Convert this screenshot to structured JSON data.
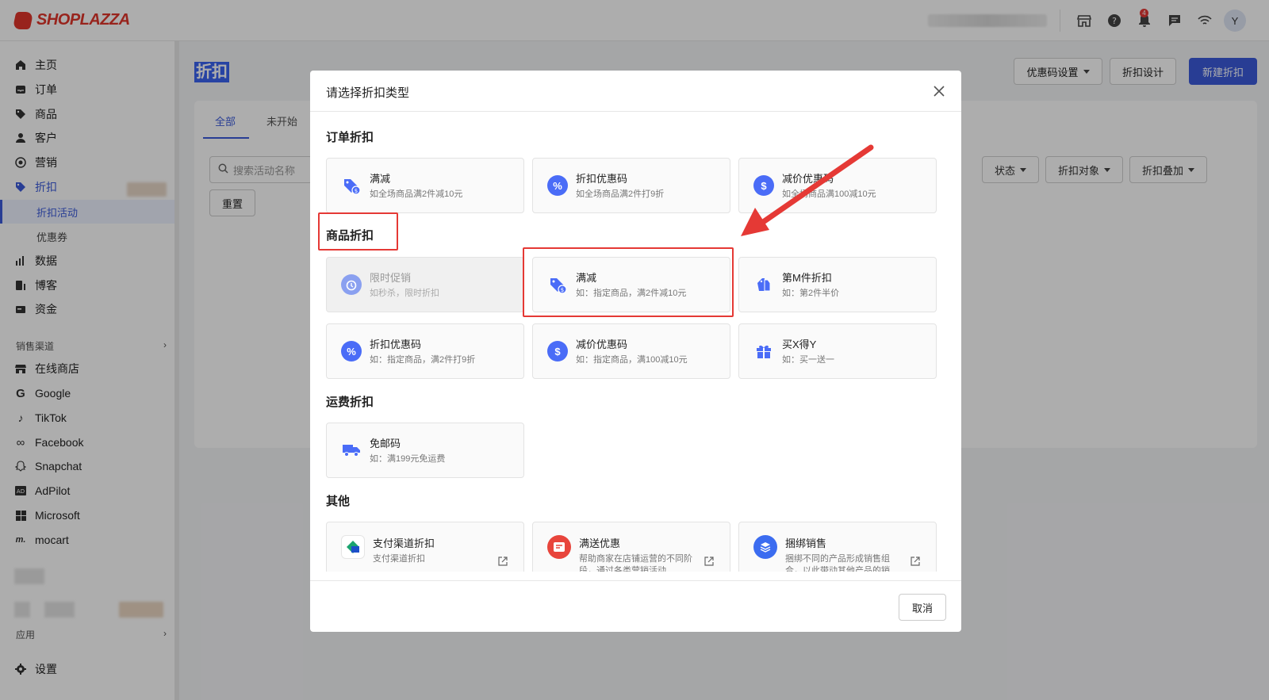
{
  "brand": {
    "name": "SHOPLAZZA"
  },
  "topbar": {
    "notification_count": "4",
    "avatar_letter": "Y"
  },
  "sidebar": {
    "items": [
      {
        "label": "主页",
        "icon": "home-icon"
      },
      {
        "label": "订单",
        "icon": "inbox-icon"
      },
      {
        "label": "商品",
        "icon": "tag-icon"
      },
      {
        "label": "客户",
        "icon": "person-icon"
      },
      {
        "label": "营销",
        "icon": "target-icon"
      },
      {
        "label": "折扣",
        "icon": "discount-icon"
      }
    ],
    "sub_items": [
      {
        "label": "折扣活动"
      },
      {
        "label": "优惠券"
      }
    ],
    "items2": [
      {
        "label": "数据",
        "icon": "bar-chart-icon"
      },
      {
        "label": "博客",
        "icon": "blog-icon"
      },
      {
        "label": "资金",
        "icon": "wallet-icon"
      }
    ],
    "channels_label": "销售渠道",
    "channels": [
      {
        "label": "在线商店",
        "icon": "store-icon"
      },
      {
        "label": "Google",
        "icon": "google-icon"
      },
      {
        "label": "TikTok",
        "icon": "tiktok-icon"
      },
      {
        "label": "Facebook",
        "icon": "meta-icon"
      },
      {
        "label": "Snapchat",
        "icon": "snapchat-icon"
      },
      {
        "label": "AdPilot",
        "icon": "ad-icon"
      },
      {
        "label": "Microsoft",
        "icon": "microsoft-icon"
      },
      {
        "label": "mocart",
        "icon": "mocart-icon"
      }
    ],
    "apps_label": "应用",
    "settings_label": "设置"
  },
  "page": {
    "title": "折扣",
    "buttons": {
      "coupon_settings": "优惠码设置",
      "discount_design": "折扣设计",
      "new_discount": "新建折扣"
    },
    "tabs": [
      "全部",
      "未开始"
    ],
    "search_placeholder": "搜索活动名称",
    "filters": [
      "状态",
      "折扣对象",
      "折扣叠加"
    ],
    "reset": "重置"
  },
  "modal": {
    "title": "请选择折扣类型",
    "sections": [
      "订单折扣",
      "商品折扣",
      "运费折扣",
      "其他"
    ],
    "order": [
      {
        "title": "满减",
        "desc": "如全场商品满2件减10元"
      },
      {
        "title": "折扣优惠码",
        "desc": "如全场商品满2件打9折"
      },
      {
        "title": "减价优惠码",
        "desc": "如全场商品满100减10元"
      }
    ],
    "product": [
      {
        "title": "限时促销",
        "desc": "如秒杀，限时折扣"
      },
      {
        "title": "满减",
        "desc": "如：指定商品，满2件减10元"
      },
      {
        "title": "第M件折扣",
        "desc": "如：第2件半价"
      },
      {
        "title": "折扣优惠码",
        "desc": "如：指定商品，满2件打9折"
      },
      {
        "title": "减价优惠码",
        "desc": "如：指定商品，满100减10元"
      },
      {
        "title": "买X得Y",
        "desc": "如：买一送一"
      }
    ],
    "shipping": [
      {
        "title": "免邮码",
        "desc": "如：满199元免运费"
      }
    ],
    "other": [
      {
        "title": "支付渠道折扣",
        "desc": "支付渠道折扣"
      },
      {
        "title": "满送优惠",
        "desc": "帮助商家在店铺运营的不同阶段，通过各类营销活动"
      },
      {
        "title": "捆绑销售",
        "desc": "捆绑不同的产品形成销售组合，以此带动其他产品的销"
      }
    ],
    "cancel": "取消"
  },
  "colors": {
    "accent": "#3b5bdb",
    "highlight": "#e53935",
    "icon_blue": "#4a6cf7"
  }
}
